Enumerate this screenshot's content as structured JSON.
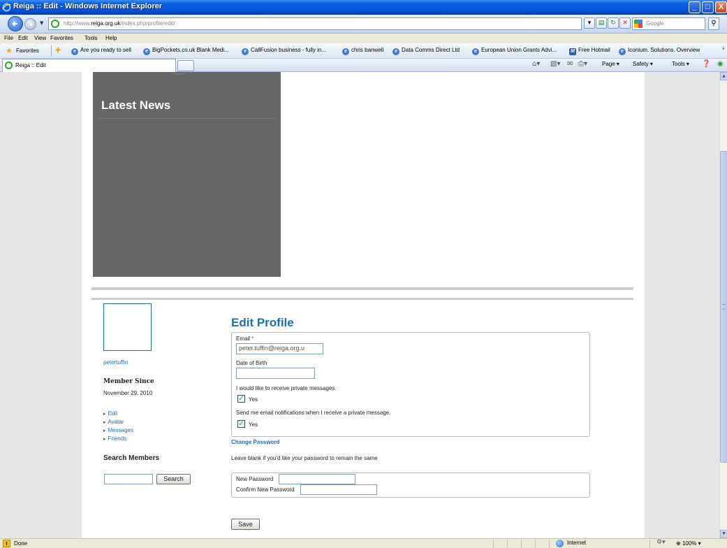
{
  "window": {
    "title": "Reiga :: Edit - Windows Internet Explorer",
    "min_label": "_",
    "max_label": "□",
    "close_label": "X"
  },
  "address_bar": {
    "url_prefix": "http://www.",
    "url_domain": "reiga.org.uk",
    "url_path": "/index.php/profile/edit/",
    "search_placeholder": "Google"
  },
  "menu": {
    "items": [
      "File",
      "Edit",
      "View",
      "Favorites",
      "Tools",
      "Help"
    ]
  },
  "favorites_bar": {
    "label": "Favorites",
    "items": [
      "Are you ready to sell",
      "BigPockets.co.uk Blank Medi...",
      "CallFusion business - fully in...",
      "chris banwell",
      "Data Comms Direct Ltd",
      "European Union Grants Advi...",
      "Free Hotmail",
      "Iconium. Solutions. Overview"
    ]
  },
  "tabs": {
    "active_title": "Reiga :: Edit"
  },
  "command_bar": {
    "page": "Page",
    "safety": "Safety",
    "tools": "Tools"
  },
  "page": {
    "latest_news_title": "Latest News",
    "sidebar": {
      "username": "petertuffin",
      "member_since_label": "Member Since",
      "member_since_date": "November 29, 2010",
      "links": [
        "Edit",
        "Avatar",
        "Messages",
        "Friends"
      ],
      "search_title": "Search Members",
      "search_button": "Search",
      "search_value": ""
    },
    "form": {
      "title": "Edit Profile",
      "email_label": "Email",
      "email_required": "*",
      "email_value": "peter.tuffin@reiga.org.u",
      "dob_label": "Date of Birth",
      "dob_value": "",
      "pm_label": "I would like to receive private messages.",
      "pm_option": "Yes",
      "pm_checked": true,
      "notify_label": "Send me email notifications when I receive a private message.",
      "notify_option": "Yes",
      "notify_checked": true,
      "change_password_title": "Change Password",
      "password_hint": "Leave blank if you'd like your password to remain the same",
      "new_password_label": "New Password",
      "confirm_password_label": "Confirm New Password",
      "save_button": "Save"
    }
  },
  "status_bar": {
    "text": "Done",
    "zone": "Internet",
    "zoom": "100%"
  },
  "colors": {
    "link_blue": "#1a6fb2",
    "news_panel": "#666666",
    "page_bg": "#e6e6e6"
  }
}
